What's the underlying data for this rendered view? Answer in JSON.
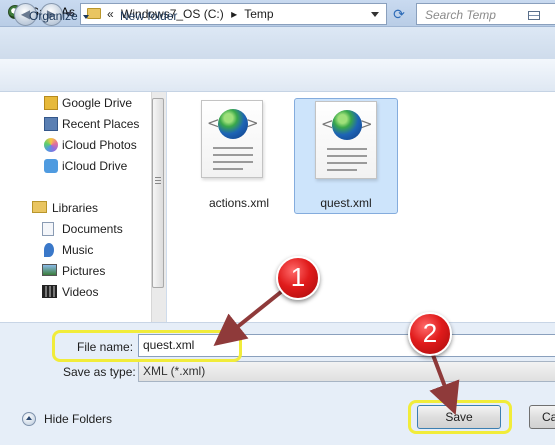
{
  "window": {
    "title": "Save As"
  },
  "address_bar": {
    "back": "◀",
    "forward": "▶",
    "crumbs": [
      "«",
      "Windows7_OS (C:)",
      "▸",
      "Temp"
    ],
    "refresh": "⟳",
    "search_placeholder": "Search Temp"
  },
  "toolbar": {
    "organize": "Organize",
    "new_folder": "New folder"
  },
  "nav_pane": {
    "favorites": [
      {
        "label": "Google Drive",
        "icon": "google-drive-icon",
        "color": "#e7b93a"
      },
      {
        "label": "Recent Places",
        "icon": "recent-places-icon",
        "color": "#5a7fb3"
      },
      {
        "label": "iCloud Photos",
        "icon": "icloud-photos-icon",
        "color": "#e46f9a"
      },
      {
        "label": "iCloud Drive",
        "icon": "icloud-drive-icon",
        "color": "#4f9be0"
      }
    ],
    "libraries_header": "Libraries",
    "libraries": [
      {
        "label": "Documents",
        "icon": "documents-icon",
        "color": "#c9d5e6"
      },
      {
        "label": "Music",
        "icon": "music-icon",
        "color": "#3a78c9"
      },
      {
        "label": "Pictures",
        "icon": "pictures-icon",
        "color": "#5a8fcf"
      },
      {
        "label": "Videos",
        "icon": "videos-icon",
        "color": "#444444"
      }
    ]
  },
  "files": [
    {
      "name": "actions.xml",
      "icon": "xml-file-icon",
      "selected": false
    },
    {
      "name": "quest.xml",
      "icon": "xml-file-icon",
      "selected": true
    }
  ],
  "form": {
    "file_name_label": "File name:",
    "file_name_value": "quest.xml",
    "save_type_label": "Save as type:",
    "save_type_value": "XML (*.xml)"
  },
  "footer": {
    "hide_folders": "Hide Folders",
    "save": "Save",
    "cancel": "Ca"
  },
  "callouts": [
    {
      "number": "1",
      "color": "#e01b1b"
    },
    {
      "number": "2",
      "color": "#e01b1b"
    }
  ],
  "highlight_color": "#f1ec3a",
  "arrow_color": "#8f3a3a"
}
